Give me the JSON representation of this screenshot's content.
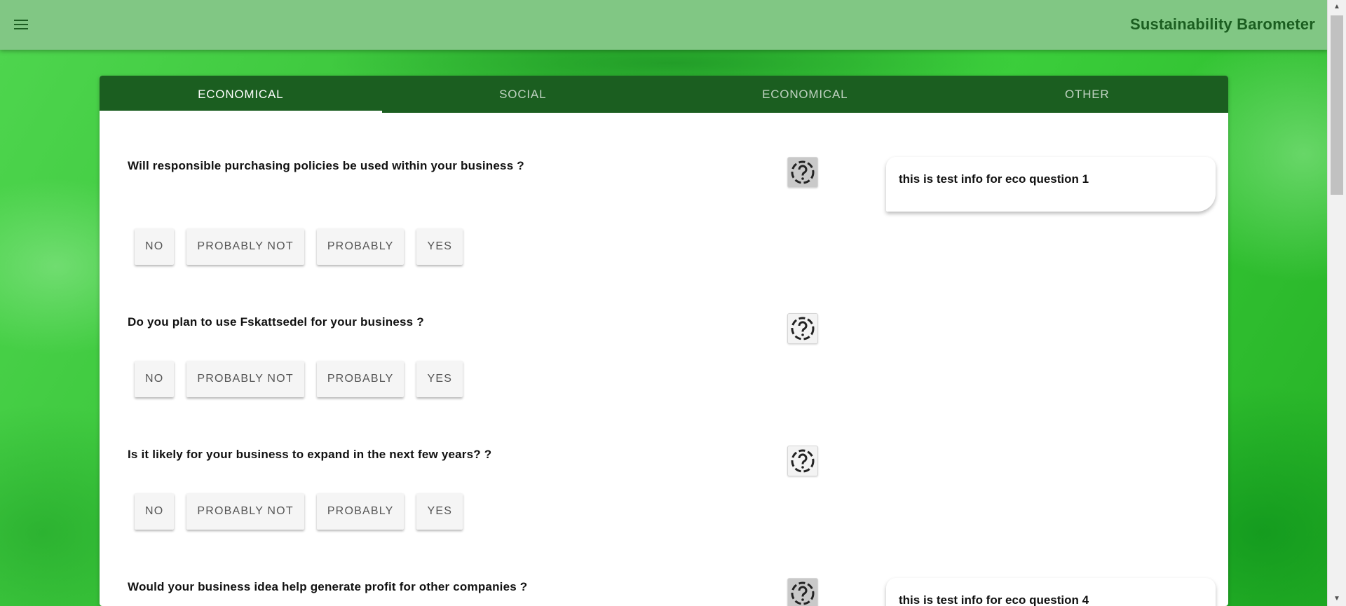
{
  "header": {
    "title": "Sustainability Barometer",
    "menu_icon": "hamburger-menu-icon"
  },
  "tabs": [
    {
      "label": "ECONOMICAL",
      "active": true
    },
    {
      "label": "SOCIAL",
      "active": false
    },
    {
      "label": "ECONOMICAL",
      "active": false
    },
    {
      "label": "OTHER",
      "active": false
    }
  ],
  "answer_options": [
    "NO",
    "PROBABLY NOT",
    "PROBABLY",
    "YES"
  ],
  "questions": [
    {
      "text": "Will responsible purchasing policies be used within your business ?",
      "help_icon": "question-mark-circle-icon",
      "info": "this is test info for eco question 1"
    },
    {
      "text": "Do you plan to use Fskattsedel for your business ?",
      "help_icon": "question-mark-circle-icon"
    },
    {
      "text": "Is it likely for your business to expand in the next few years? ?",
      "help_icon": "question-mark-circle-icon"
    },
    {
      "text": "Would your business idea help generate profit for other companies ?",
      "help_icon": "question-mark-circle-icon",
      "info": "this is test info for eco question 4"
    }
  ],
  "colors": {
    "topbar": "#81c784",
    "tabbar": "#1b5e20",
    "title": "#1b5e20"
  }
}
